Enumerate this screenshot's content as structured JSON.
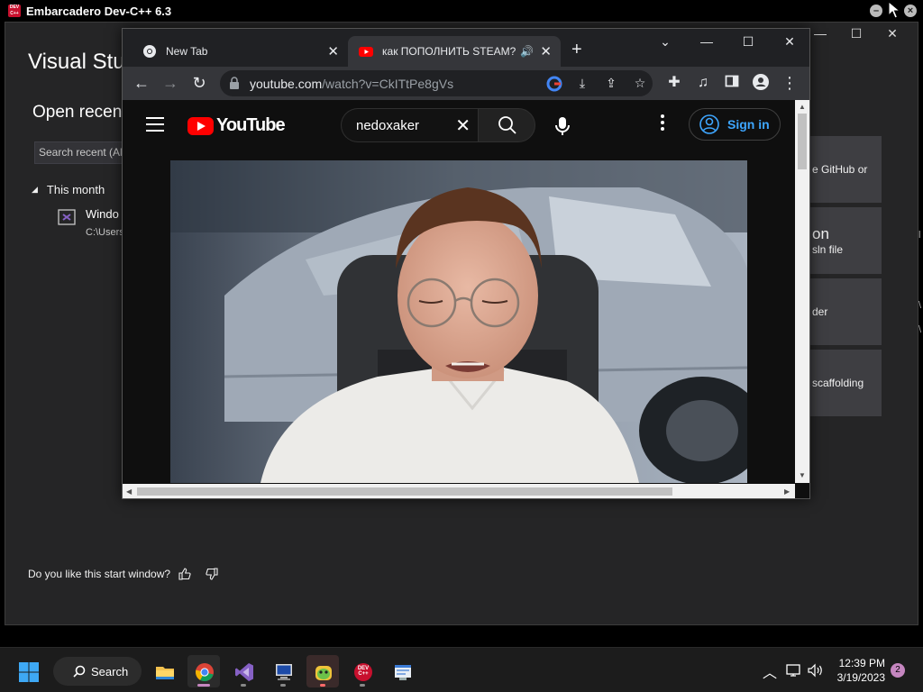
{
  "devcpp": {
    "title": "Embarcadero Dev-C++ 6.3",
    "logo_text": "DEV C++",
    "min_glyph": "–",
    "close_glyph": "×"
  },
  "vs": {
    "title": "Visual Stu",
    "open_recent": "Open recent",
    "search_placeholder": "Search recent (Alt",
    "group_label": "This month",
    "recent_item": {
      "name": "Windo",
      "path": "C:\\Users"
    },
    "cards": [
      {
        "line1": "",
        "line2": "e GitHub or"
      },
      {
        "line1": "on",
        "line2": "sln file"
      },
      {
        "line1": "",
        "line2": "der"
      },
      {
        "line1": "",
        "line2": "scaffolding"
      }
    ],
    "feedback_text": "Do you like this start window?",
    "side_glyphs": [
      "l",
      "\\",
      "\\"
    ],
    "win_min": "—",
    "win_max": "☐",
    "win_close": "✕"
  },
  "chrome": {
    "tabs": [
      {
        "title": "New Tab",
        "icon": "chrome-icon"
      },
      {
        "title": "как ПОПОЛНИТЬ STEAM? З",
        "icon": "youtube-icon"
      }
    ],
    "new_tab": "+",
    "tab_search": "⌄",
    "win_min": "—",
    "win_max": "☐",
    "win_close": "✕",
    "url_host": "youtube.com",
    "url_path": "/watch?v=CkITtPe8gVs"
  },
  "youtube": {
    "logo": "YouTube",
    "search_value": "nedoxaker",
    "sign_in": "Sign in"
  },
  "taskbar": {
    "search": "Search",
    "time": "12:39 PM",
    "date": "3/19/2023",
    "notifications": "2",
    "devcpp_label": "DEV C++"
  },
  "colors": {
    "youtube_red": "#ff0000",
    "chrome_dark": "#202124",
    "vs_purple": "#8661c5",
    "devcpp_red": "#c8102e"
  }
}
